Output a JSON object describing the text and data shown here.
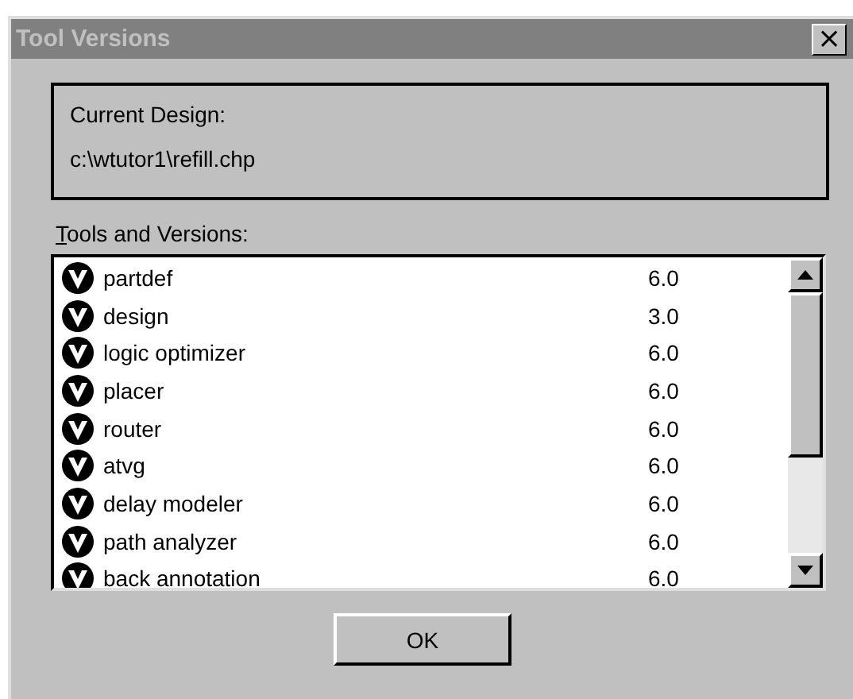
{
  "window": {
    "title": "Tool Versions",
    "active": false,
    "close_label": "×"
  },
  "current_design": {
    "label": "Current Design:",
    "value": "c:\\wtutor1\\refill.chp"
  },
  "tools": {
    "label_parts": [
      {
        "text": "T",
        "underlined": true
      },
      {
        "text": "ools and Versions:",
        "underlined": false
      }
    ],
    "rows": [
      {
        "name": "partdef",
        "version": "6.0"
      },
      {
        "name": "design",
        "version": "3.0"
      },
      {
        "name": "logic optimizer",
        "version": "6.0"
      },
      {
        "name": "placer",
        "version": "6.0"
      },
      {
        "name": "router",
        "version": "6.0"
      },
      {
        "name": "atvg",
        "version": "6.0"
      },
      {
        "name": "delay modeler",
        "version": "6.0"
      },
      {
        "name": "path analyzer",
        "version": "6.0"
      },
      {
        "name": "back annotation",
        "version": "6.0"
      }
    ]
  },
  "buttons": [
    "OK"
  ]
}
